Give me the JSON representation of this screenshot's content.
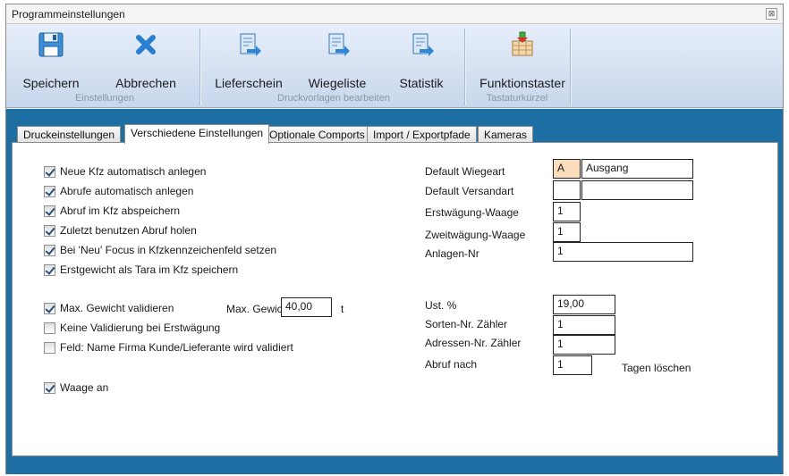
{
  "window": {
    "title": "Programmeinstellungen",
    "close_glyph": "⊠"
  },
  "ribbon": {
    "buttons": [
      {
        "label": "Speichern",
        "icon": "save-icon"
      },
      {
        "label": "Abbrechen",
        "icon": "cancel-x-icon"
      },
      {
        "label": "Lieferschein",
        "icon": "document-arrow-icon"
      },
      {
        "label": "Wiegeliste",
        "icon": "document-arrow-icon"
      },
      {
        "label": "Statistik",
        "icon": "document-arrow-icon"
      },
      {
        "label": "Funktionstaster",
        "icon": "keyboard-icon"
      }
    ],
    "groups": [
      {
        "label": "Einstellungen"
      },
      {
        "label": "Druckvorlagen bearbeiten"
      },
      {
        "label": "Tastaturkürzel"
      }
    ]
  },
  "tabs": [
    {
      "label": "Druckeinstellungen",
      "active": false
    },
    {
      "label": "Verschiedene Einstellungen",
      "active": true
    },
    {
      "label": "Optionale Comports",
      "active": false
    },
    {
      "label": "Import / Exportpfade",
      "active": false
    },
    {
      "label": "Kameras",
      "active": false
    }
  ],
  "checkboxes": [
    {
      "label": "Neue Kfz automatisch anlegen",
      "checked": true
    },
    {
      "label": "Abrufe automatisch anlegen",
      "checked": true
    },
    {
      "label": "Abruf im Kfz abspeichern",
      "checked": true
    },
    {
      "label": "Zuletzt benutzen Abruf holen",
      "checked": true
    },
    {
      "label": "Bei 'Neu' Focus in Kfzkennzeichenfeld setzen",
      "checked": true
    },
    {
      "label": "Erstgewicht als Tara im Kfz speichern",
      "checked": true
    },
    {
      "label": "Max. Gewicht validieren",
      "checked": true
    },
    {
      "label": "Keine Validierung bei Erstwägung",
      "checked": false
    },
    {
      "label": "Feld: Name Firma Kunde/Lieferante wird validiert",
      "checked": false
    },
    {
      "label": "Waage an",
      "checked": true
    }
  ],
  "max_gewicht": {
    "label": "Max. Gewicht",
    "value": "40,00",
    "unit": "t"
  },
  "fields": {
    "default_wiegeart": {
      "label": "Default Wiegeart",
      "code": "A",
      "value": "Ausgang"
    },
    "default_versandart": {
      "label": "Default Versandart",
      "code": "",
      "value": ""
    },
    "erstwaegung_waage": {
      "label": "Erstwägung-Waage",
      "value": "1"
    },
    "zweitwaegung_waage": {
      "label": "Zweitwägung-Waage",
      "value": "1"
    },
    "anlagen_nr": {
      "label": "Anlagen-Nr",
      "value": "1"
    },
    "ust": {
      "label": "Ust. %",
      "value": "19,00"
    },
    "sorten_nr": {
      "label": "Sorten-Nr. Zähler",
      "value": "1"
    },
    "adressen_nr": {
      "label": "Adressen-Nr. Zähler",
      "value": "1"
    },
    "abruf_nach": {
      "label": "Abruf nach",
      "value": "1",
      "suffix": "Tagen löschen"
    }
  }
}
